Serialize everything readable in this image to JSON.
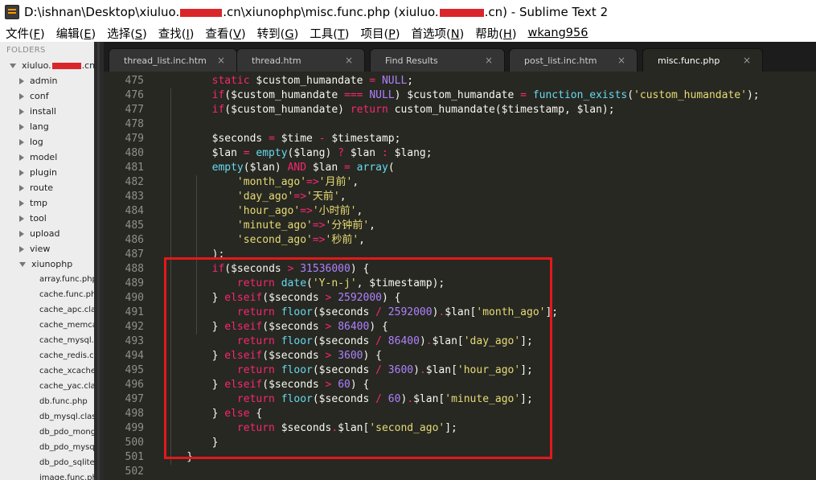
{
  "window": {
    "title_prefix": "D:\\ishnan\\Desktop\\xiuluo.",
    "title_mid": ".cn\\xiunophp\\misc.func.php (xiuluo.",
    "title_suffix": ".cn) - Sublime Text 2"
  },
  "menu": [
    {
      "pre": "文件(",
      "key": "F",
      "post": ")"
    },
    {
      "pre": "编辑(",
      "key": "E",
      "post": ")"
    },
    {
      "pre": "选择(",
      "key": "S",
      "post": ")"
    },
    {
      "pre": "查找(",
      "key": "I",
      "post": ")"
    },
    {
      "pre": "查看(",
      "key": "V",
      "post": ")"
    },
    {
      "pre": "转到(",
      "key": "G",
      "post": ")"
    },
    {
      "pre": "工具(",
      "key": "T",
      "post": ")"
    },
    {
      "pre": "项目(",
      "key": "P",
      "post": ")"
    },
    {
      "pre": "首选项(",
      "key": "N",
      "post": ")"
    },
    {
      "pre": "帮助(",
      "key": "H",
      "post": ")"
    }
  ],
  "menu_user": "wkang956",
  "sidebar": {
    "header": "FOLDERS",
    "root_prefix": "xiuluo.",
    "root_suffix": ".cn",
    "folders": [
      "admin",
      "conf",
      "install",
      "lang",
      "log",
      "model",
      "plugin",
      "route",
      "tmp",
      "tool",
      "upload",
      "view",
      "xiunophp"
    ],
    "files": [
      "array.func.php",
      "cache.func.php",
      "cache_apc.class.php",
      "cache_memcached.class.php",
      "cache_mysql.class.php",
      "cache_redis.class.php",
      "cache_xcache.class.php",
      "cache_yac.class.php",
      "db.func.php",
      "db_mysql.class.php",
      "db_pdo_mongodb.class.php",
      "db_pdo_mysql.class.php",
      "db_pdo_sqlite.class.php",
      "image.func.php"
    ]
  },
  "tabs": [
    {
      "label": "thread_list.inc.htm",
      "close": "×",
      "active": false
    },
    {
      "label": "thread.htm",
      "close": "×",
      "active": false
    },
    {
      "label": "Find Results",
      "close": "×",
      "active": false
    },
    {
      "label": "post_list.inc.htm",
      "close": "×",
      "active": false
    },
    {
      "label": "misc.func.php",
      "close": "×",
      "active": true
    }
  ],
  "colors": {
    "editor_bg": "#272822",
    "keyword": "#f92672",
    "string": "#e6db74",
    "number": "#ae81ff",
    "function": "#66d9ef",
    "annotation_box": "#e3181b"
  },
  "code": [
    {
      "n": "475",
      "t": [
        [
          "",
          "        "
        ],
        [
          "kw",
          "static"
        ],
        [
          "",
          " $custom_humandate "
        ],
        [
          "op",
          "="
        ],
        [
          "",
          " "
        ],
        [
          "const",
          "NULL"
        ],
        [
          "",
          ";"
        ]
      ]
    },
    {
      "n": "476",
      "t": [
        [
          "",
          "        "
        ],
        [
          "kw",
          "if"
        ],
        [
          "",
          "($custom_humandate "
        ],
        [
          "op",
          "==="
        ],
        [
          "",
          " "
        ],
        [
          "const",
          "NULL"
        ],
        [
          "",
          ") $custom_humandate "
        ],
        [
          "op",
          "="
        ],
        [
          "",
          " "
        ],
        [
          "fn",
          "function_exists"
        ],
        [
          "",
          "("
        ],
        [
          "str",
          "'custom_humandate'"
        ],
        [
          "",
          ");"
        ]
      ]
    },
    {
      "n": "477",
      "t": [
        [
          "",
          "        "
        ],
        [
          "kw",
          "if"
        ],
        [
          "",
          "($custom_humandate) "
        ],
        [
          "kw",
          "return"
        ],
        [
          "",
          " custom_humandate($timestamp, $lan);"
        ]
      ]
    },
    {
      "n": "478",
      "t": []
    },
    {
      "n": "479",
      "t": [
        [
          "",
          "        $seconds "
        ],
        [
          "op",
          "="
        ],
        [
          "",
          " $time "
        ],
        [
          "op",
          "-"
        ],
        [
          "",
          " $timestamp;"
        ]
      ]
    },
    {
      "n": "480",
      "t": [
        [
          "",
          "        $lan "
        ],
        [
          "op",
          "="
        ],
        [
          "",
          " "
        ],
        [
          "fn",
          "empty"
        ],
        [
          "",
          "($lang) "
        ],
        [
          "op",
          "?"
        ],
        [
          "",
          " $lan "
        ],
        [
          "op",
          ":"
        ],
        [
          "",
          " $lang;"
        ]
      ]
    },
    {
      "n": "481",
      "t": [
        [
          "",
          "        "
        ],
        [
          "fn",
          "empty"
        ],
        [
          "",
          "($lan) "
        ],
        [
          "kw",
          "AND"
        ],
        [
          "",
          " $lan "
        ],
        [
          "op",
          "="
        ],
        [
          "",
          " "
        ],
        [
          "fn",
          "array"
        ],
        [
          "",
          "("
        ]
      ]
    },
    {
      "n": "482",
      "t": [
        [
          "",
          "            "
        ],
        [
          "str",
          "'month_ago'"
        ],
        [
          "op",
          "=>"
        ],
        [
          "str",
          "'月前'"
        ],
        [
          "",
          ","
        ]
      ]
    },
    {
      "n": "483",
      "t": [
        [
          "",
          "            "
        ],
        [
          "str",
          "'day_ago'"
        ],
        [
          "op",
          "=>"
        ],
        [
          "str",
          "'天前'"
        ],
        [
          "",
          ","
        ]
      ]
    },
    {
      "n": "484",
      "t": [
        [
          "",
          "            "
        ],
        [
          "str",
          "'hour_ago'"
        ],
        [
          "op",
          "=>"
        ],
        [
          "str",
          "'小时前'"
        ],
        [
          "",
          ","
        ]
      ]
    },
    {
      "n": "485",
      "t": [
        [
          "",
          "            "
        ],
        [
          "str",
          "'minute_ago'"
        ],
        [
          "op",
          "=>"
        ],
        [
          "str",
          "'分钟前'"
        ],
        [
          "",
          ","
        ]
      ]
    },
    {
      "n": "486",
      "t": [
        [
          "",
          "            "
        ],
        [
          "str",
          "'second_ago'"
        ],
        [
          "op",
          "=>"
        ],
        [
          "str",
          "'秒前'"
        ],
        [
          "",
          ","
        ]
      ]
    },
    {
      "n": "487",
      "t": [
        [
          "",
          "        );"
        ]
      ]
    },
    {
      "n": "488",
      "t": [
        [
          "",
          "        "
        ],
        [
          "kw",
          "if"
        ],
        [
          "",
          "($seconds "
        ],
        [
          "op",
          ">"
        ],
        [
          "",
          " "
        ],
        [
          "num",
          "31536000"
        ],
        [
          "",
          ") {"
        ]
      ]
    },
    {
      "n": "489",
      "t": [
        [
          "",
          "            "
        ],
        [
          "kw",
          "return"
        ],
        [
          "",
          " "
        ],
        [
          "fn",
          "date"
        ],
        [
          "",
          "("
        ],
        [
          "str",
          "'Y-n-j'"
        ],
        [
          "",
          ", $timestamp);"
        ]
      ]
    },
    {
      "n": "490",
      "t": [
        [
          "",
          "        } "
        ],
        [
          "kw",
          "elseif"
        ],
        [
          "",
          "($seconds "
        ],
        [
          "op",
          ">"
        ],
        [
          "",
          " "
        ],
        [
          "num",
          "2592000"
        ],
        [
          "",
          ") {"
        ]
      ]
    },
    {
      "n": "491",
      "t": [
        [
          "",
          "            "
        ],
        [
          "kw",
          "return"
        ],
        [
          "",
          " "
        ],
        [
          "fn",
          "floor"
        ],
        [
          "",
          "($seconds "
        ],
        [
          "op",
          "/"
        ],
        [
          "",
          " "
        ],
        [
          "num",
          "2592000"
        ],
        [
          "",
          ")"
        ],
        [
          "op",
          "."
        ],
        [
          "",
          "$lan["
        ],
        [
          "str",
          "'month_ago'"
        ],
        [
          "",
          "];"
        ]
      ]
    },
    {
      "n": "492",
      "t": [
        [
          "",
          "        } "
        ],
        [
          "kw",
          "elseif"
        ],
        [
          "",
          "($seconds "
        ],
        [
          "op",
          ">"
        ],
        [
          "",
          " "
        ],
        [
          "num",
          "86400"
        ],
        [
          "",
          ") {"
        ]
      ]
    },
    {
      "n": "493",
      "t": [
        [
          "",
          "            "
        ],
        [
          "kw",
          "return"
        ],
        [
          "",
          " "
        ],
        [
          "fn",
          "floor"
        ],
        [
          "",
          "($seconds "
        ],
        [
          "op",
          "/"
        ],
        [
          "",
          " "
        ],
        [
          "num",
          "86400"
        ],
        [
          "",
          ")"
        ],
        [
          "op",
          "."
        ],
        [
          "",
          "$lan["
        ],
        [
          "str",
          "'day_ago'"
        ],
        [
          "",
          "];"
        ]
      ]
    },
    {
      "n": "494",
      "t": [
        [
          "",
          "        } "
        ],
        [
          "kw",
          "elseif"
        ],
        [
          "",
          "($seconds "
        ],
        [
          "op",
          ">"
        ],
        [
          "",
          " "
        ],
        [
          "num",
          "3600"
        ],
        [
          "",
          ") {"
        ]
      ]
    },
    {
      "n": "495",
      "t": [
        [
          "",
          "            "
        ],
        [
          "kw",
          "return"
        ],
        [
          "",
          " "
        ],
        [
          "fn",
          "floor"
        ],
        [
          "",
          "($seconds "
        ],
        [
          "op",
          "/"
        ],
        [
          "",
          " "
        ],
        [
          "num",
          "3600"
        ],
        [
          "",
          ")"
        ],
        [
          "op",
          "."
        ],
        [
          "",
          "$lan["
        ],
        [
          "str",
          "'hour_ago'"
        ],
        [
          "",
          "];"
        ]
      ]
    },
    {
      "n": "496",
      "t": [
        [
          "",
          "        } "
        ],
        [
          "kw",
          "elseif"
        ],
        [
          "",
          "($seconds "
        ],
        [
          "op",
          ">"
        ],
        [
          "",
          " "
        ],
        [
          "num",
          "60"
        ],
        [
          "",
          ") {"
        ]
      ]
    },
    {
      "n": "497",
      "t": [
        [
          "",
          "            "
        ],
        [
          "kw",
          "return"
        ],
        [
          "",
          " "
        ],
        [
          "fn",
          "floor"
        ],
        [
          "",
          "($seconds "
        ],
        [
          "op",
          "/"
        ],
        [
          "",
          " "
        ],
        [
          "num",
          "60"
        ],
        [
          "",
          ")"
        ],
        [
          "op",
          "."
        ],
        [
          "",
          "$lan["
        ],
        [
          "str",
          "'minute_ago'"
        ],
        [
          "",
          "];"
        ]
      ]
    },
    {
      "n": "498",
      "t": [
        [
          "",
          "        } "
        ],
        [
          "kw",
          "else"
        ],
        [
          "",
          " {"
        ]
      ]
    },
    {
      "n": "499",
      "t": [
        [
          "",
          "            "
        ],
        [
          "kw",
          "return"
        ],
        [
          "",
          " $seconds"
        ],
        [
          "op",
          "."
        ],
        [
          "",
          "$lan["
        ],
        [
          "str",
          "'second_ago'"
        ],
        [
          "",
          "];"
        ]
      ]
    },
    {
      "n": "500",
      "t": [
        [
          "",
          "        }"
        ]
      ]
    },
    {
      "n": "501",
      "t": [
        [
          "",
          "    }"
        ]
      ]
    },
    {
      "n": "502",
      "t": []
    }
  ]
}
